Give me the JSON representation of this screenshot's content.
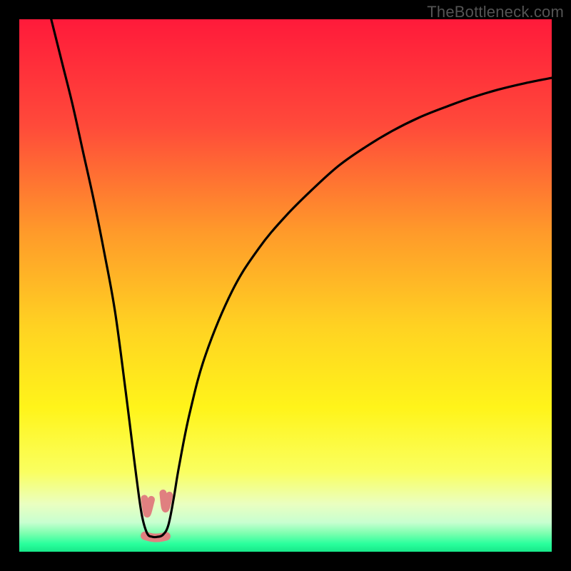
{
  "watermark": "TheBottleneck.com",
  "chart_data": {
    "type": "line",
    "title": "",
    "xlabel": "",
    "ylabel": "",
    "xlim": [
      0,
      100
    ],
    "ylim": [
      0,
      100
    ],
    "gradient_stops": [
      {
        "offset": 0,
        "color": "#ff1a3a"
      },
      {
        "offset": 0.2,
        "color": "#ff4a3a"
      },
      {
        "offset": 0.4,
        "color": "#ff9a2a"
      },
      {
        "offset": 0.58,
        "color": "#ffd322"
      },
      {
        "offset": 0.73,
        "color": "#fff41a"
      },
      {
        "offset": 0.85,
        "color": "#faff60"
      },
      {
        "offset": 0.91,
        "color": "#eaffc0"
      },
      {
        "offset": 0.945,
        "color": "#c8ffd0"
      },
      {
        "offset": 0.965,
        "color": "#7fffb0"
      },
      {
        "offset": 0.985,
        "color": "#2aff9d"
      },
      {
        "offset": 1.0,
        "color": "#18e889"
      }
    ],
    "series": [
      {
        "name": "bottleneck-curve",
        "color": "#000000",
        "x": [
          6,
          8,
          10,
          12,
          14,
          16,
          18,
          20,
          21,
          22,
          23,
          24,
          25,
          26,
          27,
          28,
          29,
          30,
          32,
          35,
          40,
          45,
          50,
          55,
          60,
          65,
          70,
          75,
          80,
          85,
          90,
          95,
          100
        ],
        "y": [
          100,
          92,
          84,
          75,
          66,
          56,
          45,
          30,
          22,
          14,
          7,
          3.5,
          2.8,
          2.8,
          3.2,
          5,
          10,
          16,
          26,
          37,
          49,
          57,
          63,
          68,
          72.5,
          76,
          79,
          81.5,
          83.5,
          85.3,
          86.8,
          88,
          89
        ]
      }
    ],
    "markers": [
      {
        "name": "nub-left",
        "path_xy": [
          [
            23.5,
            10.0
          ],
          [
            23.9,
            7.2
          ],
          [
            24.1,
            7.0
          ],
          [
            24.8,
            9.8
          ]
        ],
        "stroke": "#e08080",
        "width": 10
      },
      {
        "name": "nub-right",
        "path_xy": [
          [
            27.0,
            11.0
          ],
          [
            27.3,
            8.1
          ],
          [
            27.6,
            8.0
          ],
          [
            28.2,
            10.6
          ]
        ],
        "stroke": "#e08080",
        "width": 10
      },
      {
        "name": "nub-bottom",
        "path_xy": [
          [
            23.6,
            3.0
          ],
          [
            25.0,
            2.6
          ],
          [
            26.3,
            2.6
          ],
          [
            27.6,
            2.9
          ]
        ],
        "stroke": "#e08080",
        "width": 12
      }
    ]
  }
}
